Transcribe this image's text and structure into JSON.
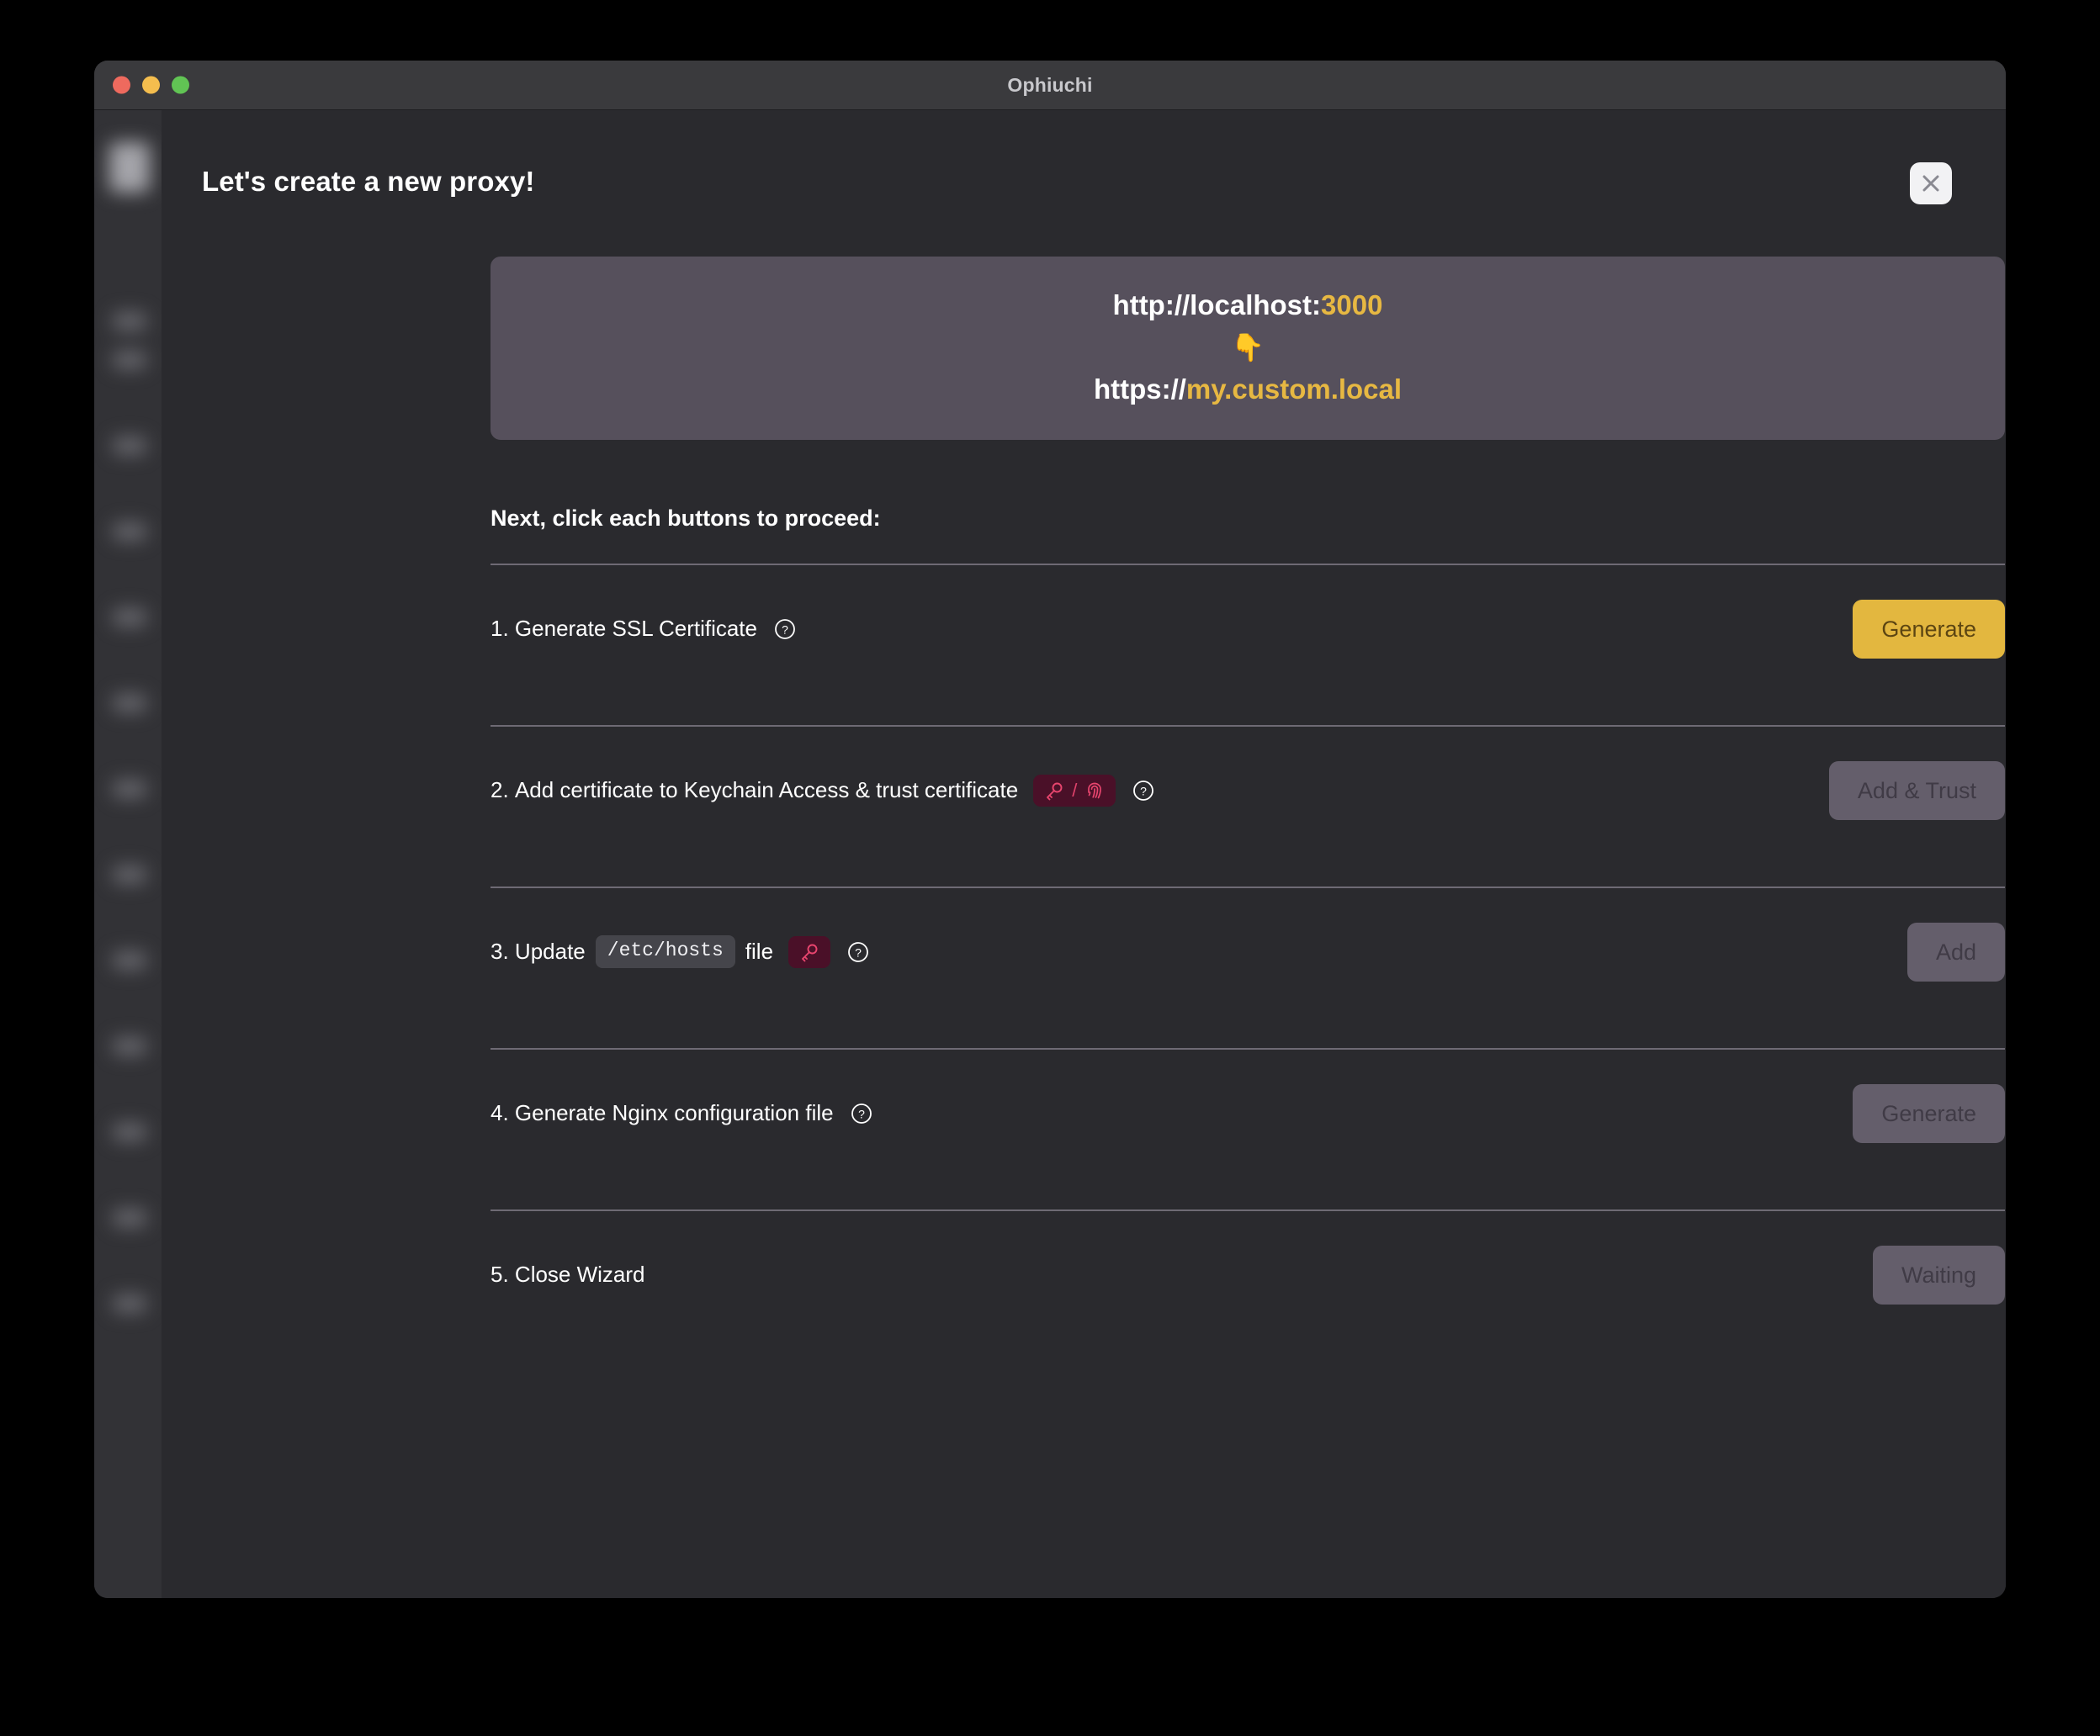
{
  "window": {
    "title": "Ophiuchi",
    "traffic_lights": [
      "close",
      "minimize",
      "zoom"
    ]
  },
  "modal": {
    "title": "Let's create a new proxy!",
    "close_label": "close",
    "url_preview": {
      "source_prefix": "http://localhost:",
      "source_port": "3000",
      "arrow_emoji": "👇",
      "target_prefix": "https://",
      "target_host": "my.custom.local"
    },
    "instructions": "Next, click each buttons to proceed:",
    "steps": [
      {
        "number": "1.",
        "text": "Generate SSL Certificate",
        "code": "",
        "text_after": "",
        "badge": "",
        "help": true,
        "button": {
          "label": "Generate",
          "state": "primary"
        }
      },
      {
        "number": "2.",
        "text": "Add certificate to Keychain Access & trust certificate",
        "code": "",
        "text_after": "",
        "badge": "key-fingerprint",
        "help": true,
        "button": {
          "label": "Add & Trust",
          "state": "disabled"
        }
      },
      {
        "number": "3.",
        "text": "Update",
        "code": "/etc/hosts",
        "text_after": "file",
        "badge": "key",
        "help": true,
        "button": {
          "label": "Add",
          "state": "disabled"
        }
      },
      {
        "number": "4.",
        "text": "Generate Nginx configuration file",
        "code": "",
        "text_after": "",
        "badge": "",
        "help": true,
        "button": {
          "label": "Generate",
          "state": "disabled"
        }
      },
      {
        "number": "5.",
        "text": "Close Wizard",
        "code": "",
        "text_after": "",
        "badge": "",
        "help": false,
        "button": {
          "label": "Waiting",
          "state": "disabled"
        }
      }
    ]
  },
  "colors": {
    "accent": "#E3B73F",
    "card_bg": "#56505C",
    "window_bg": "#2A2A2E",
    "titlebar_bg": "#3A3A3D",
    "badge_bg": "#4A1028",
    "badge_fg": "#E8456E",
    "disabled_button": "#645E6B"
  }
}
